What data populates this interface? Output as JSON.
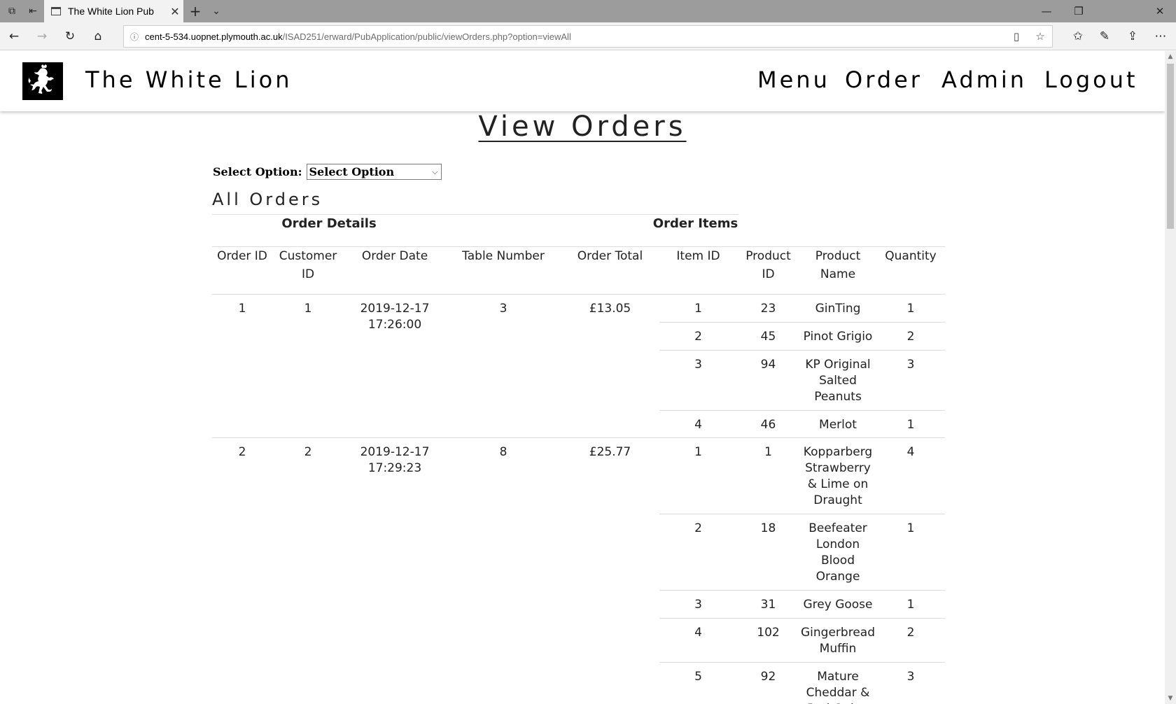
{
  "browser": {
    "tab_title": "The White Lion Pub",
    "url_host": "cent-5-534.uopnet.plymouth.ac.uk",
    "url_path": "/ISAD251/erward/PubApplication/public/viewOrders.php?option=viewAll"
  },
  "site": {
    "title": "The White Lion",
    "nav": [
      "Menu",
      "Order",
      "Admin",
      "Logout"
    ]
  },
  "page": {
    "heading": "View Orders",
    "select_label": "Select Option:",
    "select_value": "Select Option",
    "section_heading": "All Orders"
  },
  "table": {
    "group_headers": [
      "Order Details",
      "Order Items"
    ],
    "columns": [
      "Order ID",
      "Customer ID",
      "Order Date",
      "Table Number",
      "Order Total",
      "Item ID",
      "Product ID",
      "Product Name",
      "Quantity"
    ],
    "orders": [
      {
        "order_id": "1",
        "customer_id": "1",
        "date": "2019-12-17",
        "time": "17:26:00",
        "table_number": "3",
        "total": "£13.05",
        "items": [
          {
            "item_id": "1",
            "product_id": "23",
            "product_name": "GinTing",
            "quantity": "1"
          },
          {
            "item_id": "2",
            "product_id": "45",
            "product_name": "Pinot Grigio",
            "quantity": "2"
          },
          {
            "item_id": "3",
            "product_id": "94",
            "product_name": "KP Original Salted Peanuts",
            "quantity": "3"
          },
          {
            "item_id": "4",
            "product_id": "46",
            "product_name": "Merlot",
            "quantity": "1"
          }
        ]
      },
      {
        "order_id": "2",
        "customer_id": "2",
        "date": "2019-12-17",
        "time": "17:29:23",
        "table_number": "8",
        "total": "£25.77",
        "items": [
          {
            "item_id": "1",
            "product_id": "1",
            "product_name": "Kopparberg Strawberry & Lime on Draught",
            "quantity": "4"
          },
          {
            "item_id": "2",
            "product_id": "18",
            "product_name": "Beefeater London Blood Orange",
            "quantity": "1"
          },
          {
            "item_id": "3",
            "product_id": "31",
            "product_name": "Grey Goose",
            "quantity": "1"
          },
          {
            "item_id": "4",
            "product_id": "102",
            "product_name": "Gingerbread Muffin",
            "quantity": "2"
          },
          {
            "item_id": "5",
            "product_id": "92",
            "product_name": "Mature Cheddar & Red Onion",
            "quantity": "3"
          }
        ]
      }
    ]
  }
}
